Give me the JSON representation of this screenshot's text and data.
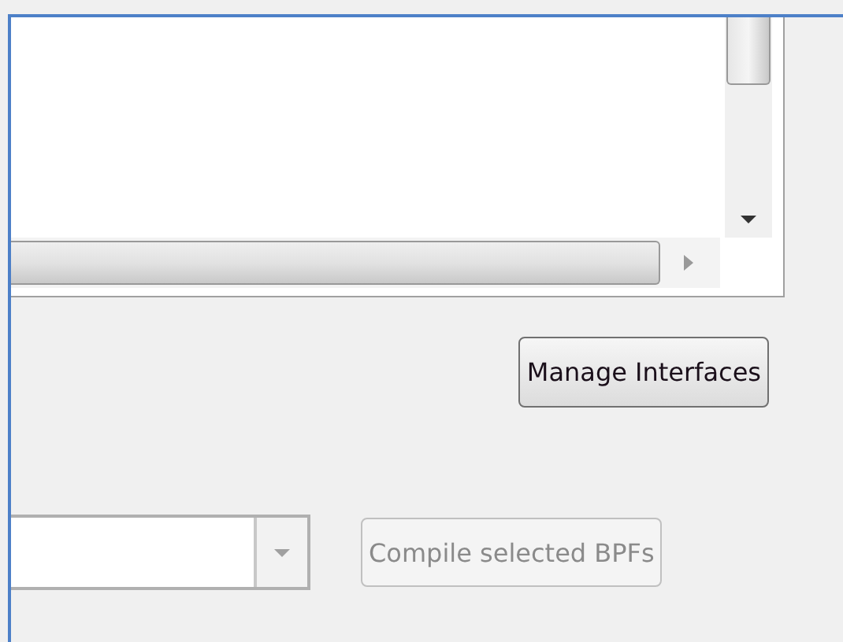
{
  "manage_button": {
    "label": "Manage Interfaces",
    "disabled": false
  },
  "compile_button": {
    "label": "Compile selected BPFs",
    "disabled": true
  }
}
